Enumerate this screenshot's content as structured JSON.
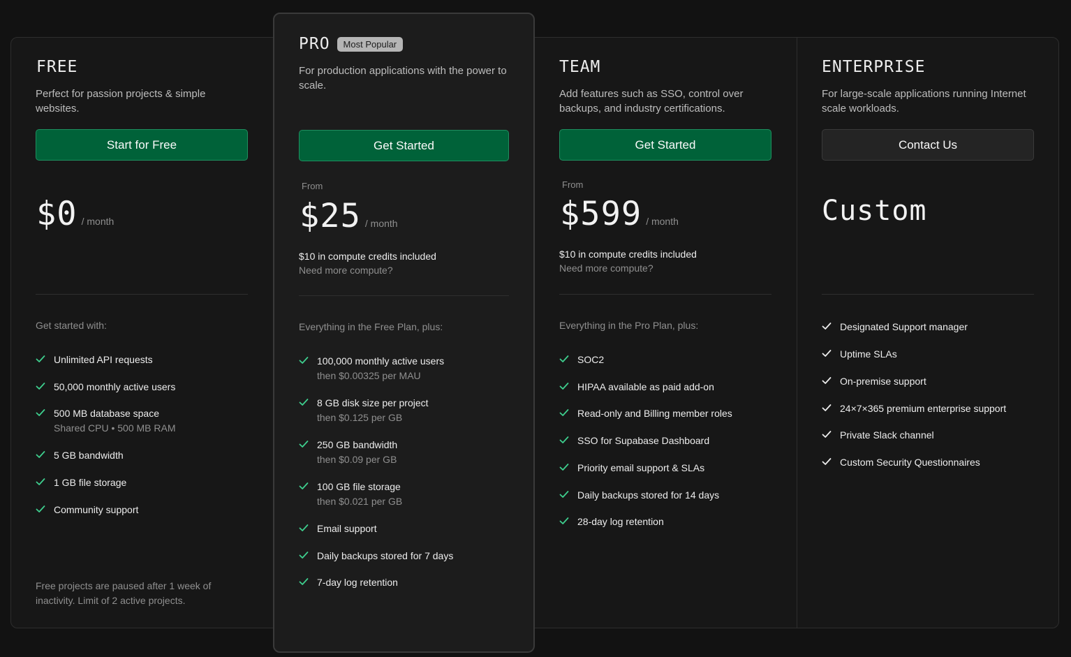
{
  "plans": {
    "free": {
      "name": "FREE",
      "description": "Perfect for passion projects & simple websites.",
      "button": "Start for Free",
      "price": "$0",
      "per": "/ month",
      "intro": "Get started with:",
      "features": [
        {
          "text": "Unlimited API requests"
        },
        {
          "text": "50,000 monthly active users"
        },
        {
          "text": "500 MB database space",
          "sub": "Shared CPU • 500 MB RAM"
        },
        {
          "text": "5 GB bandwidth"
        },
        {
          "text": "1 GB file storage"
        },
        {
          "text": "Community support"
        }
      ],
      "footnote": "Free projects are paused after 1 week of inactivity. Limit of 2 active projects."
    },
    "pro": {
      "name": "PRO",
      "badge": "Most Popular",
      "description": "For production applications with the power to scale.",
      "button": "Get Started",
      "from": "From",
      "price": "$25",
      "per": "/ month",
      "credits": "$10 in compute credits included",
      "more_compute": "Need more compute?",
      "intro": "Everything in the Free Plan, plus:",
      "features": [
        {
          "text": "100,000 monthly active users",
          "sub": "then $0.00325 per MAU"
        },
        {
          "text": "8 GB disk size per project",
          "sub": "then $0.125 per GB"
        },
        {
          "text": "250 GB bandwidth",
          "sub": "then $0.09 per GB"
        },
        {
          "text": "100 GB file storage",
          "sub": "then $0.021 per GB"
        },
        {
          "text": "Email support"
        },
        {
          "text": "Daily backups stored for 7 days"
        },
        {
          "text": "7-day log retention"
        }
      ]
    },
    "team": {
      "name": "TEAM",
      "description": "Add features such as SSO, control over backups, and industry certifications.",
      "button": "Get Started",
      "from": "From",
      "price": "$599",
      "per": "/ month",
      "credits": "$10 in compute credits included",
      "more_compute": "Need more compute?",
      "intro": "Everything in the Pro Plan, plus:",
      "features": [
        {
          "text": "SOC2"
        },
        {
          "text": "HIPAA available as paid add-on"
        },
        {
          "text": "Read-only and Billing member roles"
        },
        {
          "text": "SSO for Supabase Dashboard"
        },
        {
          "text": "Priority email support & SLAs"
        },
        {
          "text": "Daily backups stored for 14 days"
        },
        {
          "text": "28-day log retention"
        }
      ]
    },
    "enterprise": {
      "name": "ENTERPRISE",
      "description": "For large-scale applications running Internet scale workloads.",
      "button": "Contact Us",
      "price": "Custom",
      "features": [
        {
          "text": "Designated Support manager"
        },
        {
          "text": "Uptime SLAs"
        },
        {
          "text": "On-premise support"
        },
        {
          "text": "24×7×365 premium enterprise support"
        },
        {
          "text": "Private Slack channel"
        },
        {
          "text": "Custom Security Questionnaires"
        }
      ]
    }
  },
  "colors": {
    "accent_green": "#006239",
    "check_green": "#3ecf8e",
    "check_white": "#ededed"
  }
}
